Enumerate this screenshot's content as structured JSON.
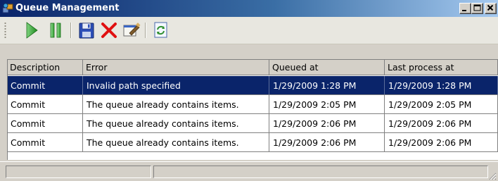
{
  "window": {
    "title": "Queue Management"
  },
  "caption_buttons": {
    "minimize": "_",
    "maximize": "□",
    "close": "✕"
  },
  "toolbar": {
    "buttons": [
      {
        "name": "start",
        "icon": "play-icon",
        "color": "#2ca02c"
      },
      {
        "name": "pause",
        "icon": "pause-icon",
        "color": "#2ca02c"
      },
      {
        "name": "save",
        "icon": "floppy-disk-icon",
        "color": "#1f3b9b"
      },
      {
        "name": "delete",
        "icon": "red-x-icon",
        "color": "#e01010"
      },
      {
        "name": "properties",
        "icon": "edit-properties-icon"
      },
      {
        "name": "refresh",
        "icon": "refresh-icon",
        "color": "#2f8f2f"
      }
    ]
  },
  "grid": {
    "columns": [
      "Description",
      "Error",
      "Queued at",
      "Last process at"
    ],
    "rows": [
      {
        "description": "Commit",
        "error": "Invalid path specified",
        "queued_at": "1/29/2009 1:28 PM",
        "last_process_at": "1/29/2009 1:28 PM",
        "selected": true
      },
      {
        "description": "Commit",
        "error": "The queue already contains items.",
        "queued_at": "1/29/2009 2:05 PM",
        "last_process_at": "1/29/2009 2:05 PM",
        "selected": false
      },
      {
        "description": "Commit",
        "error": "The queue already contains items.",
        "queued_at": "1/29/2009 2:06 PM",
        "last_process_at": "1/29/2009 2:06 PM",
        "selected": false
      },
      {
        "description": "Commit",
        "error": "The queue already contains items.",
        "queued_at": "1/29/2009 2:06 PM",
        "last_process_at": "1/29/2009 2:06 PM",
        "selected": false
      }
    ]
  },
  "colors": {
    "selection": "#0a246a",
    "titlebar_start": "#0a246a",
    "titlebar_end": "#a6caf0"
  }
}
